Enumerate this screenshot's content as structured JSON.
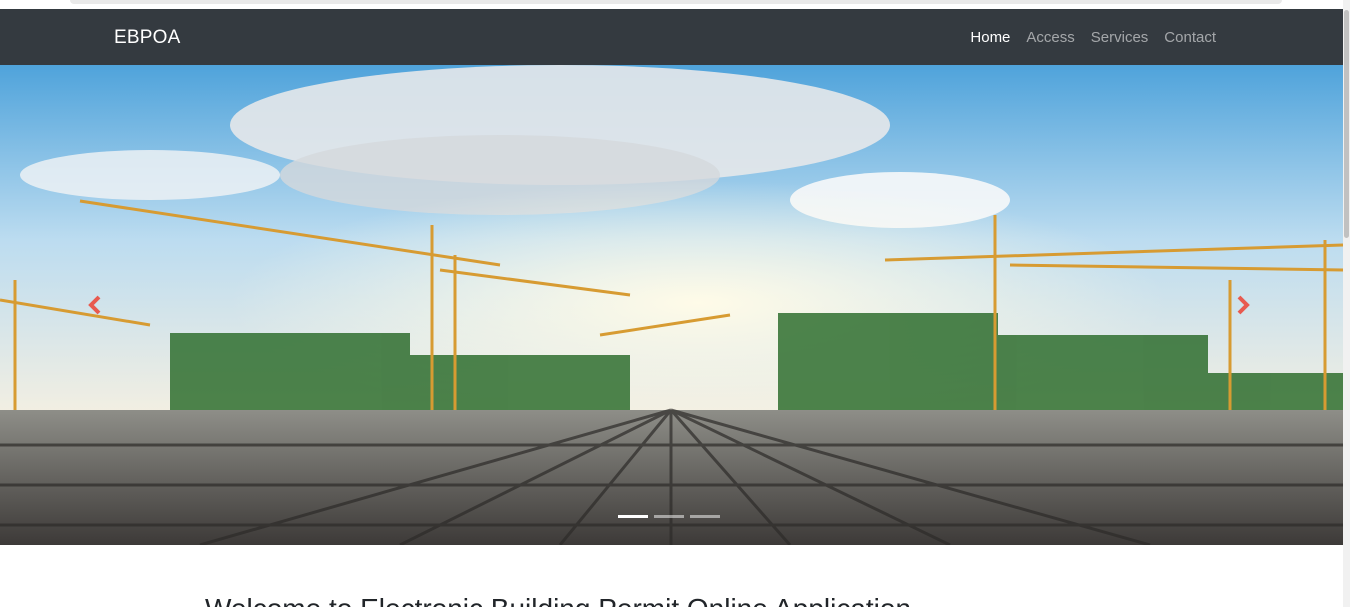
{
  "navbar": {
    "brand": "EBPOA",
    "links": [
      {
        "label": "Home",
        "active": true
      },
      {
        "label": "Access",
        "active": false
      },
      {
        "label": "Services",
        "active": false
      },
      {
        "label": "Contact",
        "active": false
      }
    ]
  },
  "carousel": {
    "slide_count": 3,
    "active_slide": 1,
    "prev_icon": "chevron-left-icon",
    "next_icon": "chevron-right-icon",
    "control_color": "#e85a4f"
  },
  "main": {
    "heading": "Welcome to Electronic Building Permit Online Application"
  },
  "colors": {
    "navbar_bg": "#343a40",
    "nav_active": "#ffffff",
    "nav_inactive": "rgba(255,255,255,0.55)"
  }
}
